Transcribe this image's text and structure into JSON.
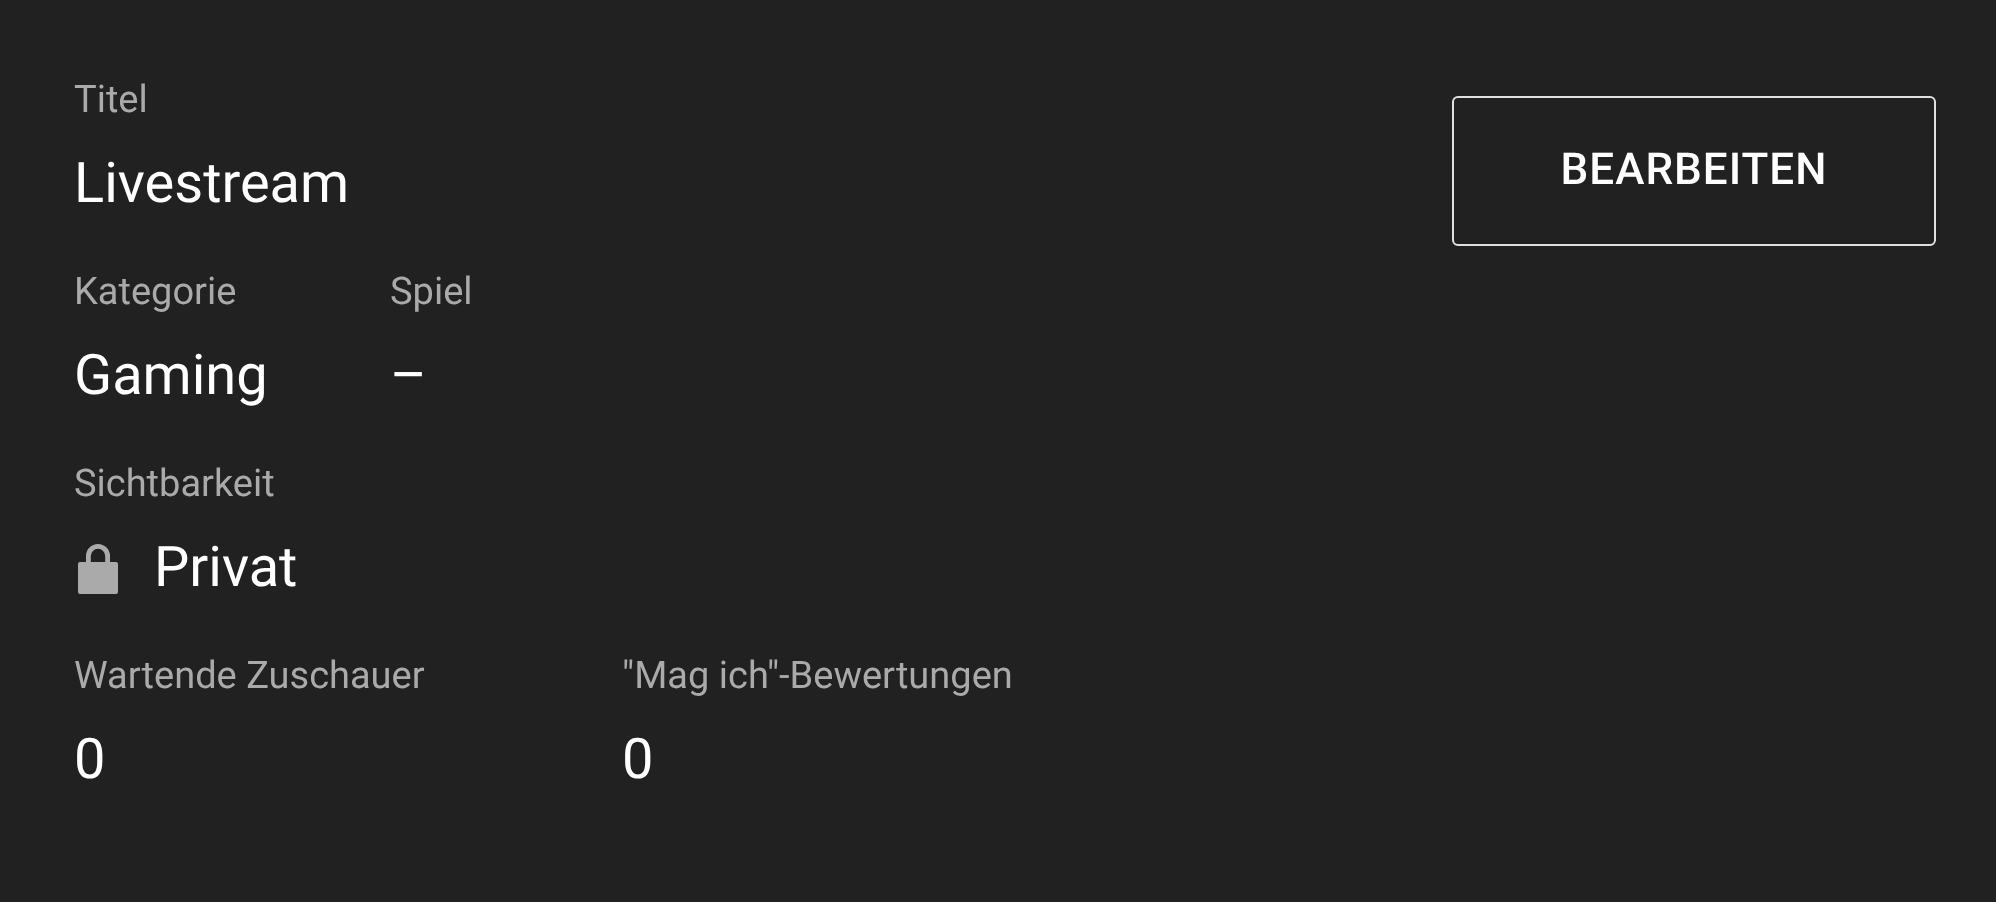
{
  "title_field": {
    "label": "Titel",
    "value": "Livestream"
  },
  "edit_button": "BEARBEITEN",
  "rows": [
    {
      "fields": [
        {
          "label": "Kategorie",
          "value": "Gaming"
        },
        {
          "label": "Spiel",
          "value": "–"
        }
      ]
    },
    {
      "fields": [
        {
          "label": "Sichtbarkeit",
          "value": "Privat",
          "kind": "locked"
        }
      ]
    },
    {
      "fields": [
        {
          "label": "Wartende Zuschauer",
          "value": "0"
        },
        {
          "label": "\"Mag ich\"-Bewertungen",
          "value": "0"
        }
      ]
    }
  ]
}
